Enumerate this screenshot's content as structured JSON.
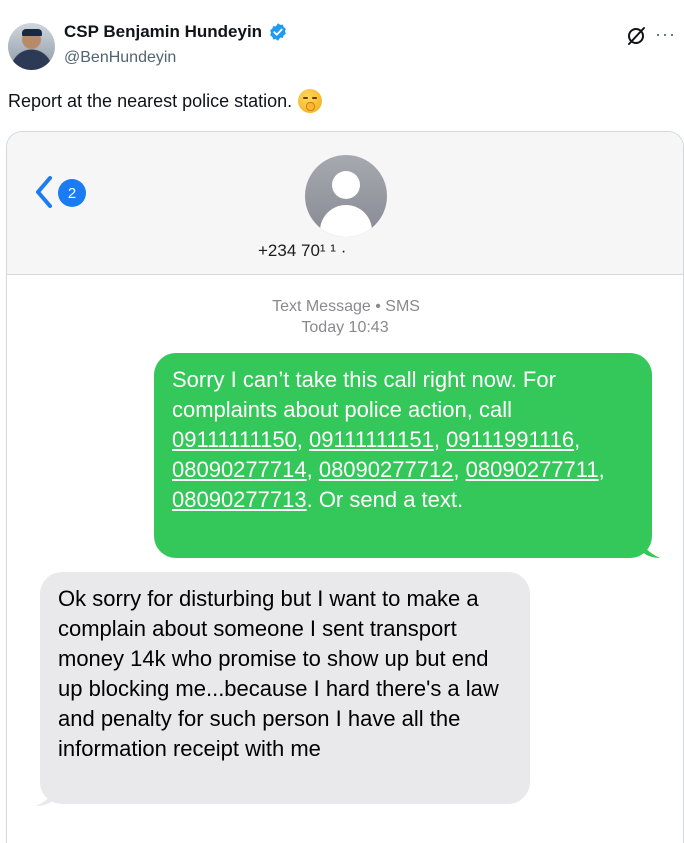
{
  "post": {
    "display_name": "CSP Benjamin Hundeyin",
    "handle": "@BenHundeyin",
    "text": "Report at the nearest police station.",
    "emoji_name": "shushing-face-emoji",
    "more_label": "···",
    "verified_color": "#1d9bf0"
  },
  "sms": {
    "unread_count": "2",
    "contact_number": "+234 70¹ ¹ ·",
    "meta_type": "Text Message • SMS",
    "meta_time": "Today 10:43",
    "outgoing": {
      "lead": "Sorry I can’t take this call right now. For complaints about police action, call ",
      "numbers": [
        "09111111150",
        "09111111151",
        "09111991116",
        "08090277714",
        "08090277712",
        "08090277711",
        "08090277713"
      ],
      "tail": ". Or send a text."
    },
    "incoming": {
      "text": "Ok sorry for disturbing but I want to make a complain about someone I sent transport money 14k who promise to show up but end up blocking me...because I hard there's a law and penalty for such person I have all the information receipt with me"
    },
    "colors": {
      "outgoing_bubble": "#34c759",
      "incoming_bubble": "#e9e9eb",
      "ios_blue": "#1a7cf0"
    }
  }
}
